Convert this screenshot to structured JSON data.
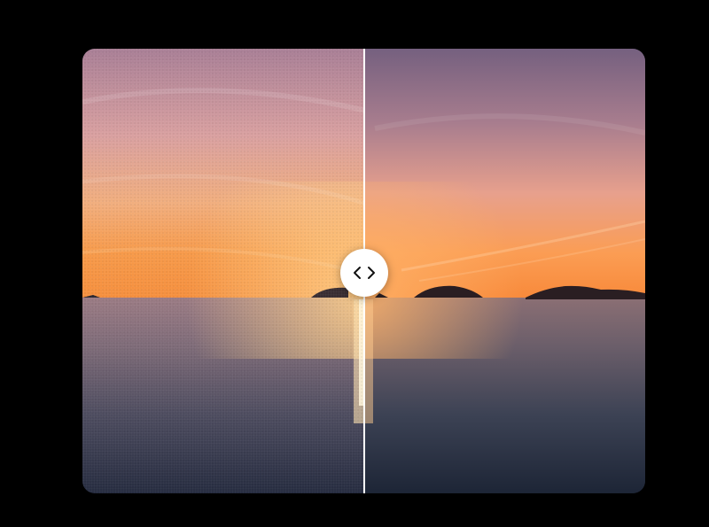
{
  "comparison": {
    "split_fraction": 0.5,
    "left_variant": "before",
    "right_variant": "after",
    "handle_icon": "chevron-left-right-icon"
  },
  "colors": {
    "page_background": "#000000",
    "divider": "#ffffff",
    "handle_background": "#ffffff",
    "handle_icon": "#111111"
  }
}
